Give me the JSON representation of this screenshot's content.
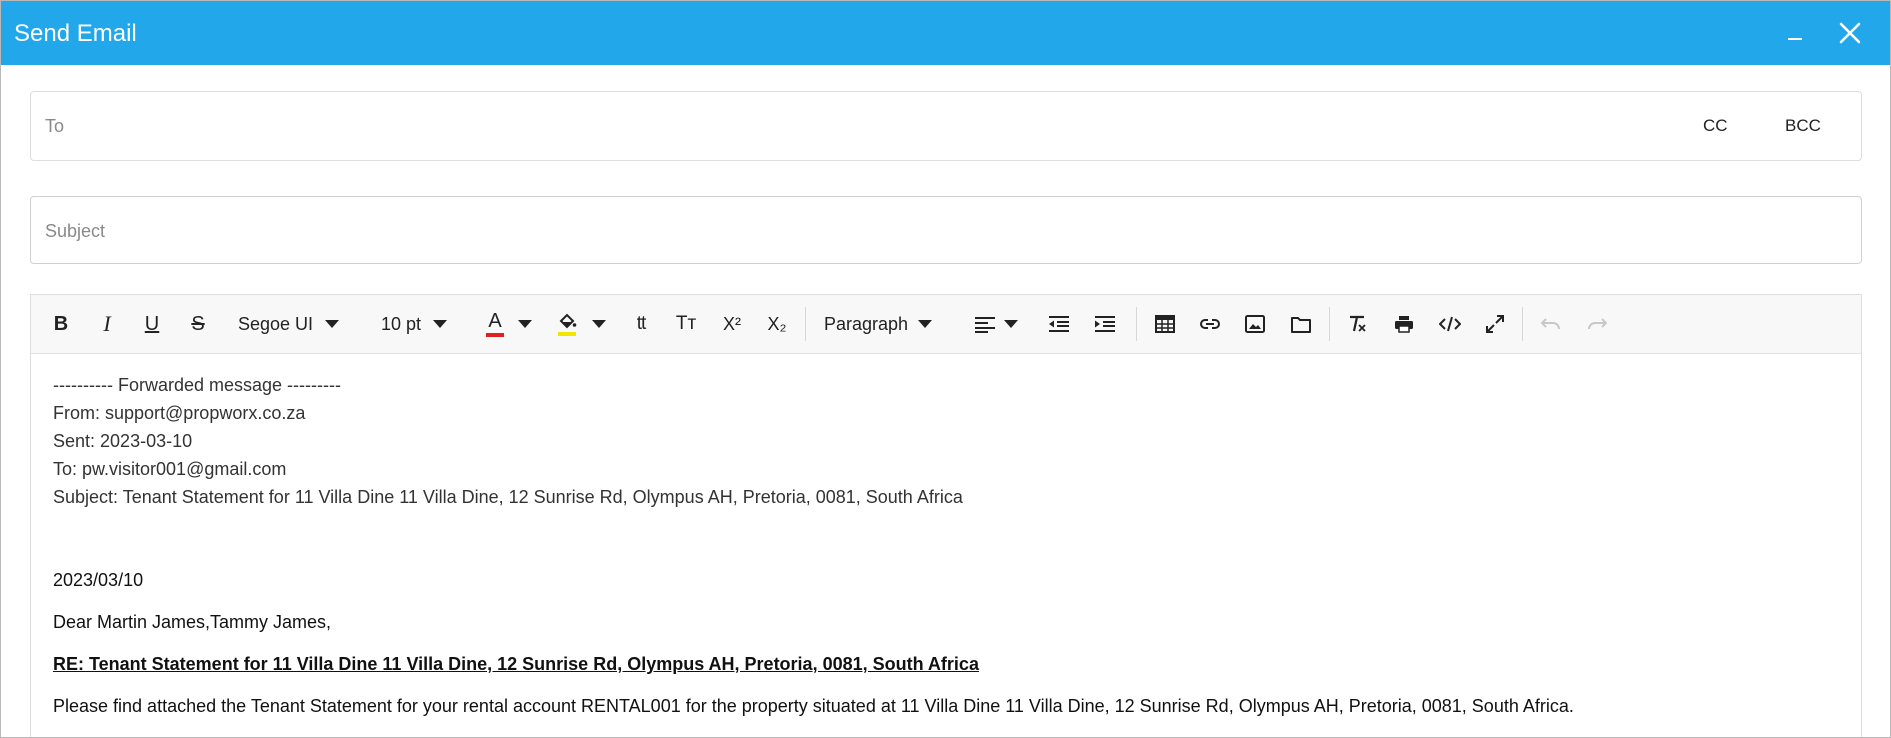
{
  "window": {
    "title": "Send Email"
  },
  "to_field": {
    "placeholder": "To",
    "cc_label": "CC",
    "bcc_label": "BCC"
  },
  "subject_field": {
    "placeholder": "Subject"
  },
  "toolbar": {
    "bold": "B",
    "italic": "I",
    "underline": "U",
    "strikethrough": "S",
    "font_family": "Segoe UI",
    "font_size": "10 pt",
    "font_color_label": "A",
    "font_color": "#e02020",
    "highlight_color": "#f2e600",
    "uppercase": "tt",
    "capitalize": "Tт",
    "superscript": "X²",
    "subscript": "X₂",
    "format": "Paragraph"
  },
  "message": {
    "forward_header": "---------- Forwarded message ---------",
    "from": "From: support@propworx.co.za",
    "sent": "Sent: 2023-03-10",
    "to": "To: pw.visitor001@gmail.com",
    "subject": "Subject: Tenant Statement for 11 Villa Dine 11 Villa Dine, 12 Sunrise Rd, Olympus AH, Pretoria, 0081, South Africa",
    "date": "2023/03/10",
    "greeting": "Dear Martin James,Tammy James,",
    "re_line": "RE: Tenant Statement for 11 Villa Dine 11 Villa Dine, 12 Sunrise Rd, Olympus AH, Pretoria, 0081, South Africa",
    "body": "Please find attached the Tenant Statement for your rental account RENTAL001 for the property situated at 11 Villa Dine 11 Villa Dine, 12 Sunrise Rd, Olympus AH, Pretoria, 0081, South Africa."
  },
  "icons": {
    "minimize": "minimize-icon",
    "close": "close-icon",
    "align": "align-left-icon",
    "outdent": "outdent-icon",
    "indent": "indent-icon",
    "table": "table-icon",
    "link": "link-icon",
    "image": "image-icon",
    "file": "folder-icon",
    "clear_format": "clear-format-icon",
    "print": "print-icon",
    "source": "code-view-icon",
    "fullscreen": "fullscreen-icon",
    "undo": "undo-icon",
    "redo": "redo-icon"
  },
  "colors": {
    "titlebar": "#22a7ea"
  }
}
